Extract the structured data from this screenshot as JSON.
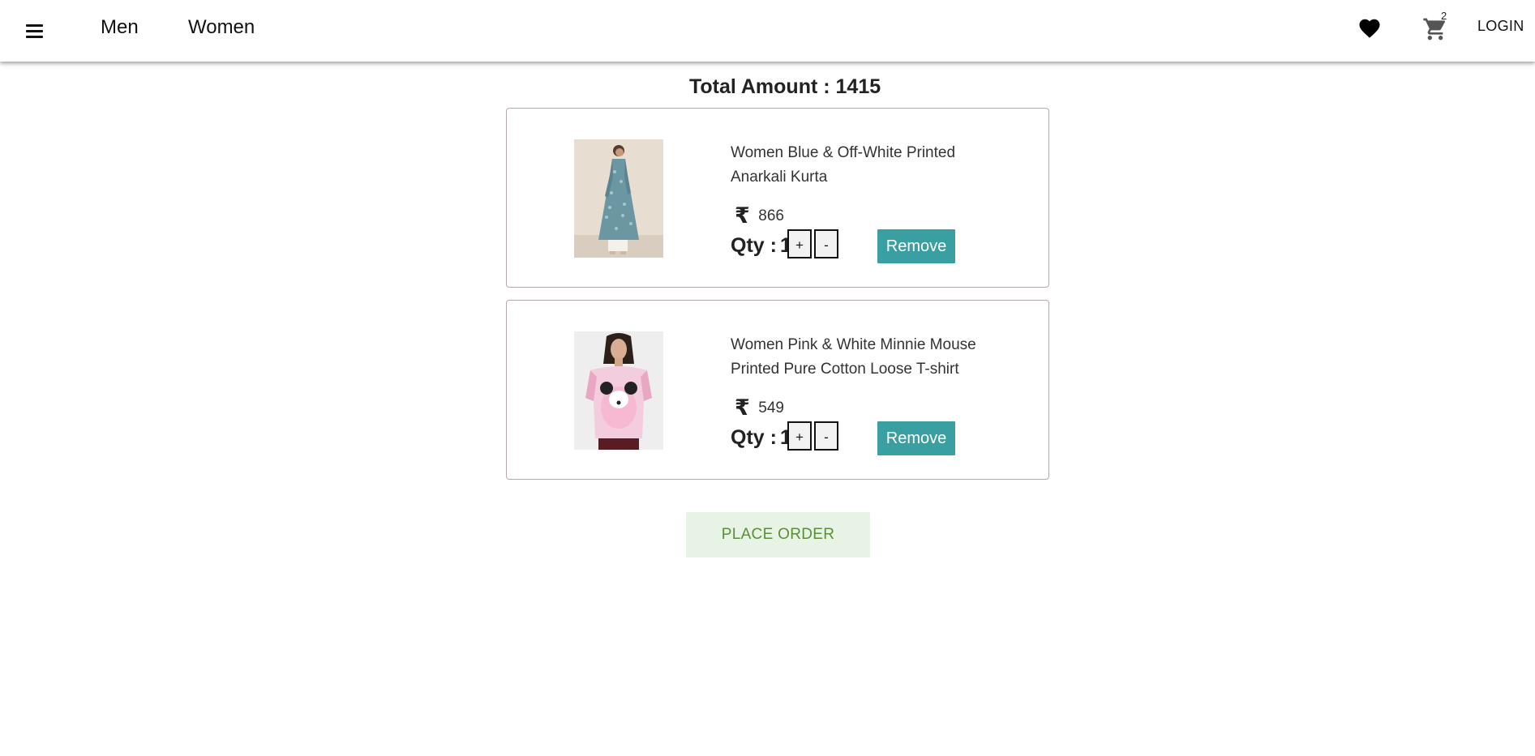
{
  "header": {
    "nav": [
      {
        "label": "Men"
      },
      {
        "label": "Women"
      }
    ],
    "icons": {
      "menu": "menu-icon",
      "wishlist": "heart-icon",
      "cart": "cart-icon"
    },
    "cart_count": "2",
    "login_label": "LOGIN"
  },
  "cart": {
    "total_label": "Total Amount : 1415",
    "items": [
      {
        "name": "Women Blue & Off-White Printed Anarkali Kurta",
        "currency_symbol": "₹",
        "price": "866",
        "qty_label": "Qty :",
        "qty": "1",
        "plus_label": "+",
        "minus_label": "-",
        "remove_label": "Remove"
      },
      {
        "name": "Women Pink & White Minnie Mouse Printed Pure Cotton Loose T-shirt",
        "currency_symbol": "₹",
        "price": "549",
        "qty_label": "Qty :",
        "qty": "1",
        "plus_label": "+",
        "minus_label": "-",
        "remove_label": "Remove"
      }
    ],
    "place_order_label": "PLACE ORDER"
  },
  "colors": {
    "remove_button": "#3a9fa0",
    "place_order_bg": "#e7f3e4",
    "place_order_text": "#5b8e38"
  }
}
